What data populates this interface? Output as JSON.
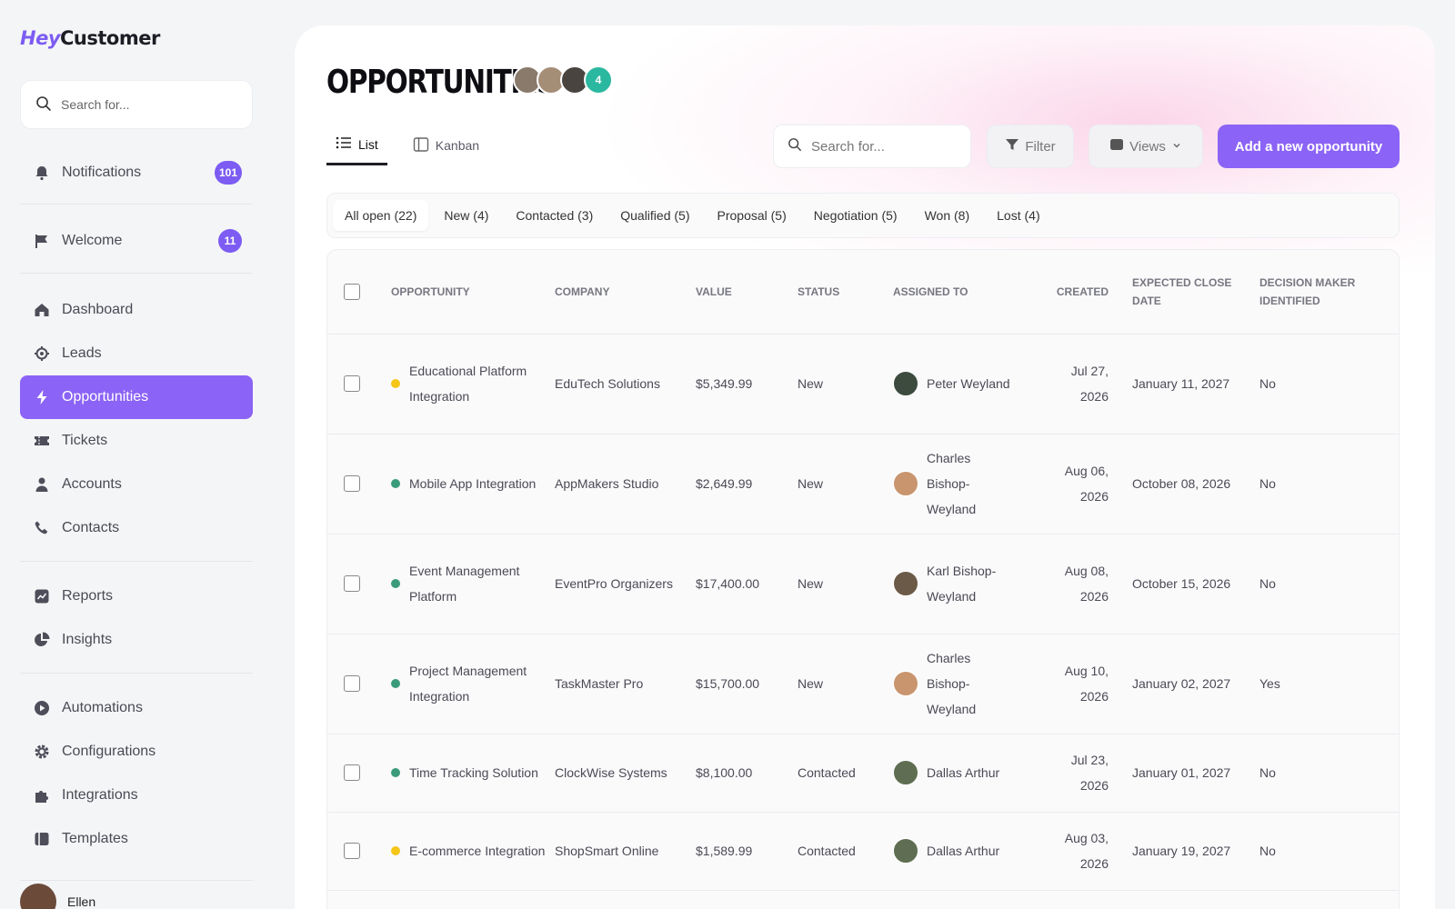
{
  "brand": {
    "logo_part1": "Hey",
    "logo_part2": "Customer"
  },
  "sidebar": {
    "search_placeholder": "Search for...",
    "items": [
      {
        "label": "Notifications",
        "icon": "bell-icon",
        "badge": "101"
      },
      {
        "label": "Welcome",
        "icon": "flag-icon",
        "badge": "11"
      },
      {
        "label": "Dashboard",
        "icon": "home-icon"
      },
      {
        "label": "Leads",
        "icon": "target-icon"
      },
      {
        "label": "Opportunities",
        "icon": "bolt-icon",
        "active": true
      },
      {
        "label": "Tickets",
        "icon": "ticket-icon"
      },
      {
        "label": "Accounts",
        "icon": "user-icon"
      },
      {
        "label": "Contacts",
        "icon": "phone-icon"
      },
      {
        "label": "Reports",
        "icon": "chart-icon"
      },
      {
        "label": "Insights",
        "icon": "pie-icon"
      },
      {
        "label": "Automations",
        "icon": "play-icon"
      },
      {
        "label": "Configurations",
        "icon": "gear-icon"
      },
      {
        "label": "Integrations",
        "icon": "puzzle-icon"
      },
      {
        "label": "Templates",
        "icon": "template-icon"
      }
    ],
    "user_name": "Ellen"
  },
  "header": {
    "title": "OPPORTUNITIES",
    "avatar_count": "4",
    "view_tabs": [
      "List",
      "Kanban"
    ],
    "search_placeholder": "Search for...",
    "filter_label": "Filter",
    "views_label": "Views",
    "add_button_label": "Add a new opportunity"
  },
  "status_tabs": [
    "All open (22)",
    "New (4)",
    "Contacted (3)",
    "Qualified (5)",
    "Proposal (5)",
    "Negotiation (5)",
    "Won (8)",
    "Lost (4)"
  ],
  "colors": {
    "accent": "#8b63f6",
    "badge": "#7c5cf2",
    "dot_yellow": "#f5c518",
    "dot_green": "#3a9b7a",
    "avatar_teal": "#2bb8a0"
  },
  "table": {
    "columns": [
      "Opportunity",
      "Company",
      "Value",
      "Status",
      "Assigned to",
      "Created",
      "Expected close date",
      "Decision maker identified"
    ],
    "rows": [
      {
        "opportunity": "Educational Platform Integration",
        "dot": "yellow",
        "company": "EduTech Solutions",
        "value": "$5,349.99",
        "status": "New",
        "assigned": "Peter Weyland",
        "created": "Jul 27, 2026",
        "close": "January 11, 2027",
        "decision": "No"
      },
      {
        "opportunity": "Mobile App Integration",
        "dot": "green",
        "company": "AppMakers Studio",
        "value": "$2,649.99",
        "status": "New",
        "assigned": "Charles Bishop-Weyland",
        "created": "Aug 06, 2026",
        "close": "October 08, 2026",
        "decision": "No"
      },
      {
        "opportunity": "Event Management Platform",
        "dot": "green",
        "company": "EventPro Organizers",
        "value": "$17,400.00",
        "status": "New",
        "assigned": "Karl Bishop-Weyland",
        "created": "Aug 08, 2026",
        "close": "October 15, 2026",
        "decision": "No"
      },
      {
        "opportunity": "Project Management Integration",
        "dot": "green",
        "company": "TaskMaster Pro",
        "value": "$15,700.00",
        "status": "New",
        "assigned": "Charles Bishop-Weyland",
        "created": "Aug 10, 2026",
        "close": "January 02, 2027",
        "decision": "Yes"
      },
      {
        "opportunity": "Time Tracking Solution",
        "dot": "green",
        "company": "ClockWise Systems",
        "value": "$8,100.00",
        "status": "Contacted",
        "assigned": "Dallas Arthur",
        "created": "Jul 23, 2026",
        "close": "January 01, 2027",
        "decision": "No"
      },
      {
        "opportunity": "E-commerce Integration",
        "dot": "yellow",
        "company": "ShopSmart Online",
        "value": "$1,589.99",
        "status": "Contacted",
        "assigned": "Dallas Arthur",
        "created": "Aug 03, 2026",
        "close": "January 19, 2027",
        "decision": "No"
      }
    ]
  }
}
